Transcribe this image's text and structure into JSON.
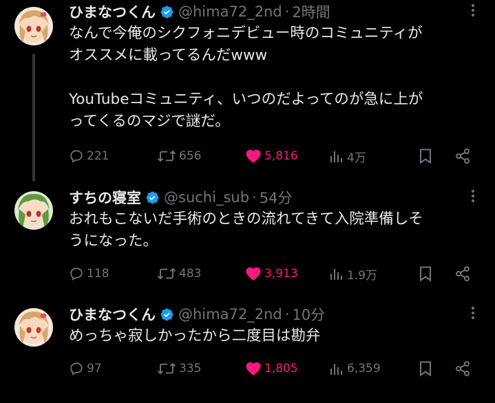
{
  "tweets": [
    {
      "name": "ひまなつくん",
      "handle": "@hima72_2nd",
      "time": "2時間",
      "lines": [
        "なんで今俺のシクフォニデビュー時のコミュニティが",
        "オススメに載ってるんだwww",
        "",
        "YouTubeコミュニティ、いつのだよってのが急に上が",
        "ってくるのマジで謎だ。"
      ],
      "replies": "221",
      "retweets": "656",
      "likes": "5,816",
      "views": "4万"
    },
    {
      "name": "すちの寝室",
      "handle": "@suchi_sub",
      "time": "54分",
      "lines": [
        "おれもこないだ手術のときの流れてきて入院準備しそ",
        "うになった。"
      ],
      "replies": "118",
      "retweets": "483",
      "likes": "3,913",
      "views": "1.9万"
    },
    {
      "name": "ひまなつくん",
      "handle": "@hima72_2nd",
      "time": "10分",
      "lines": [
        "めっちゃ寂しかったから二度目は勘弁"
      ],
      "replies": "97",
      "retweets": "335",
      "likes": "1,805",
      "views": "6,359"
    }
  ],
  "separator": "·",
  "icons": {
    "reply": "reply-icon",
    "retweet": "retweet-icon",
    "like": "heart-icon",
    "views": "views-icon",
    "bookmark": "bookmark-icon",
    "share": "share-icon",
    "verified": "verified-badge-icon",
    "more": "more-icon"
  },
  "colors": {
    "background": "#000000",
    "text": "#e7e9ea",
    "muted": "#71767b",
    "like": "#f91880",
    "verified": "#1d9bf0",
    "thread_line": "#333639"
  }
}
